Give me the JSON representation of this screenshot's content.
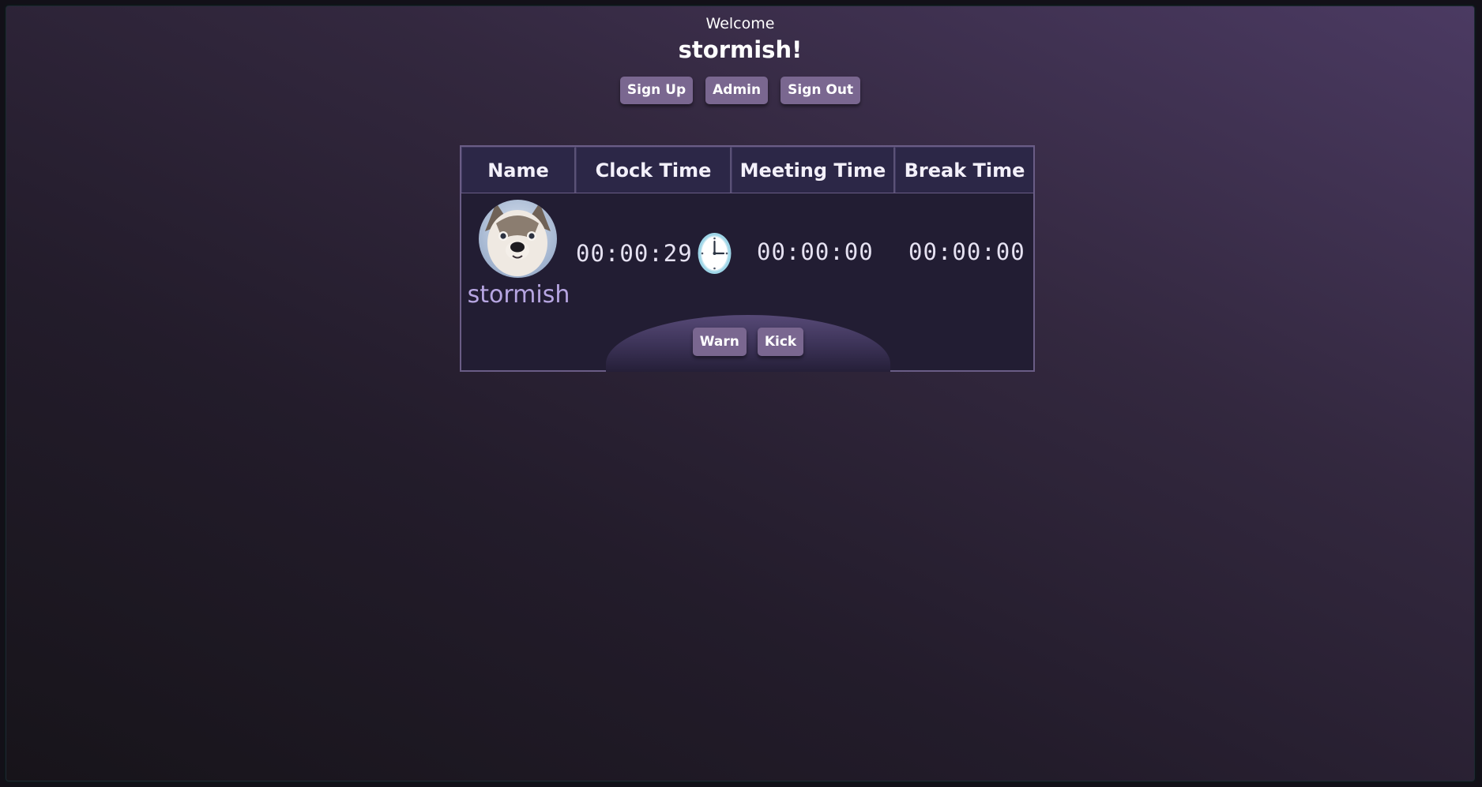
{
  "header": {
    "welcome": "Welcome",
    "username_title": "stormish!"
  },
  "nav": {
    "signup": "Sign Up",
    "admin": "Admin",
    "signout": "Sign Out"
  },
  "table": {
    "columns": [
      "Name",
      "Clock Time",
      "Meeting Time",
      "Break Time"
    ],
    "rows": [
      {
        "name": "stormish",
        "clock_time": "00:00:29",
        "meeting_time": "00:00:00",
        "break_time": "00:00:00",
        "avatar": "husky-dog-avatar",
        "status_icon": "clock-icon",
        "actions": {
          "warn": "Warn",
          "kick": "Kick"
        }
      }
    ]
  },
  "colors": {
    "button": "#7a6790",
    "table_bg": "#221d33",
    "header_bg": "#2c2747",
    "name_text": "#b7a6e2"
  }
}
